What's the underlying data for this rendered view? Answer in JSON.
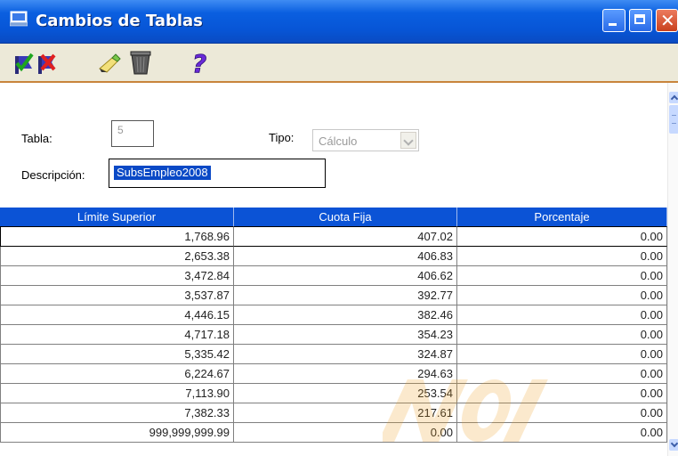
{
  "window": {
    "title": "Cambios de Tablas",
    "title_bar_color": "#0a5fe0",
    "buttons": [
      "minimize-icon",
      "maximize-icon",
      "close-icon"
    ]
  },
  "toolbar": {
    "items": [
      {
        "name": "accept",
        "icon": "check-flag-icon"
      },
      {
        "name": "cancel",
        "icon": "cancel-flag-icon"
      },
      {
        "name": "edit",
        "icon": "pencil-icon"
      },
      {
        "name": "delete",
        "icon": "trash-icon"
      },
      {
        "name": "help",
        "icon": "question-mark-icon"
      }
    ],
    "accent_color": "#c8843c"
  },
  "form": {
    "tabla_label": "Tabla:",
    "tabla_value": "5",
    "tipo_label": "Tipo:",
    "tipo_value": "Cálculo",
    "descripcion_label": "Descripción:",
    "descripcion_value": "SubsEmpleo2008"
  },
  "table": {
    "header_color": "#0b53d6",
    "columns": [
      "Límite Superior",
      "Cuota Fija",
      "Porcentaje"
    ],
    "rows": [
      [
        "1,768.96",
        "407.02",
        "0.00"
      ],
      [
        "2,653.38",
        "406.83",
        "0.00"
      ],
      [
        "3,472.84",
        "406.62",
        "0.00"
      ],
      [
        "3,537.87",
        "392.77",
        "0.00"
      ],
      [
        "4,446.15",
        "382.46",
        "0.00"
      ],
      [
        "4,717.18",
        "354.23",
        "0.00"
      ],
      [
        "5,335.42",
        "324.87",
        "0.00"
      ],
      [
        "6,224.67",
        "294.63",
        "0.00"
      ],
      [
        "7,113.90",
        "253.54",
        "0.00"
      ],
      [
        "7,382.33",
        "217.61",
        "0.00"
      ],
      [
        "999,999,999.99",
        "0.00",
        "0.00"
      ]
    ]
  },
  "watermark": {
    "text": "NOI",
    "color": "#f0a020"
  }
}
